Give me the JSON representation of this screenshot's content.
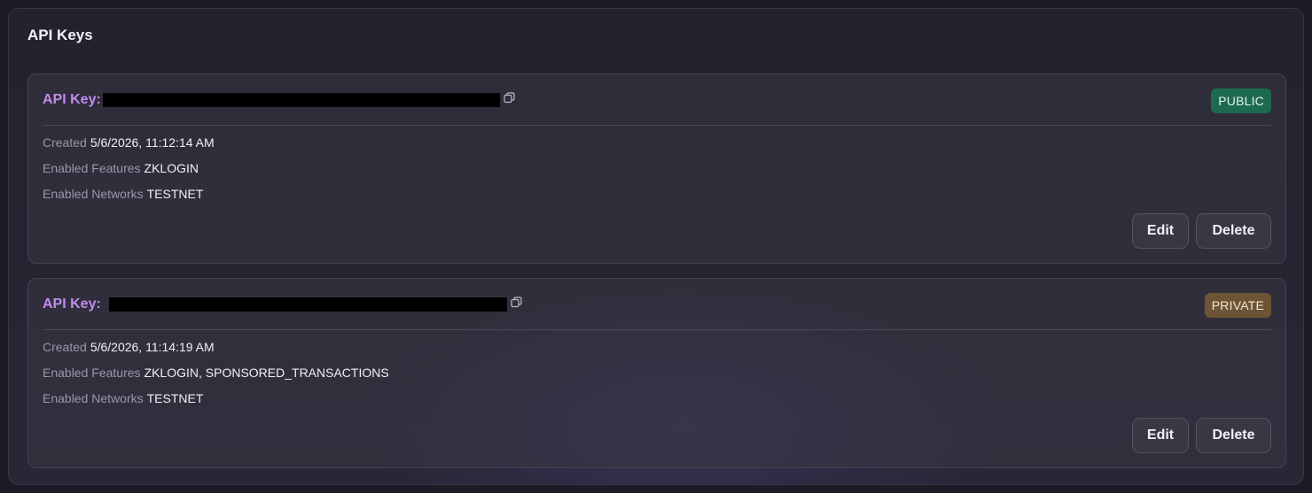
{
  "panel": {
    "title": "API Keys"
  },
  "keys": [
    {
      "label": "API Key:",
      "badge": "PUBLIC",
      "created_label": "Created",
      "created_value": "5/6/2026, 11:12:14 AM",
      "features_label": "Enabled Features",
      "features_value": "ZKLOGIN",
      "networks_label": "Enabled Networks",
      "networks_value": "TESTNET",
      "edit_label": "Edit",
      "delete_label": "Delete"
    },
    {
      "label": "API Key:",
      "badge": "PRIVATE",
      "created_label": "Created",
      "created_value": "5/6/2026, 11:14:19 AM",
      "features_label": "Enabled Features",
      "features_value": "ZKLOGIN, SPONSORED_TRANSACTIONS",
      "networks_label": "Enabled Networks",
      "networks_value": "TESTNET",
      "edit_label": "Edit",
      "delete_label": "Delete"
    }
  ],
  "colors": {
    "accent": "#c08cf0",
    "public_badge": "#1e6a50",
    "private_badge": "#6c5434"
  },
  "icons": {
    "copy": "copy-icon"
  }
}
